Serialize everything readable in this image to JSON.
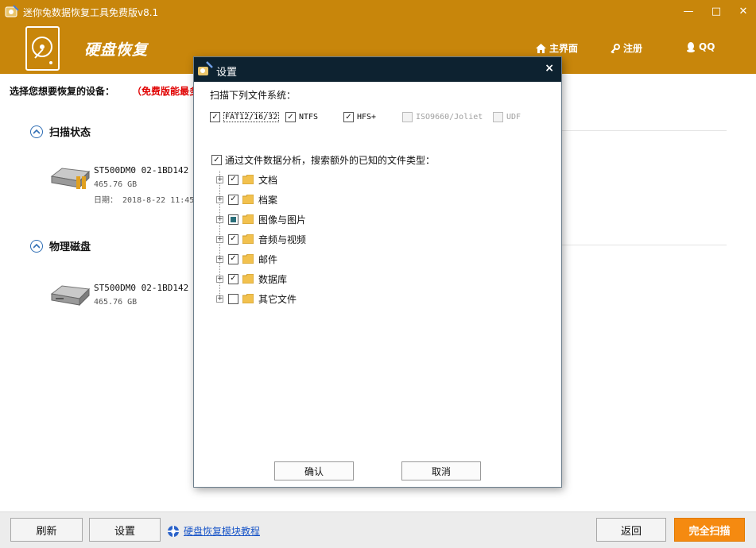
{
  "window": {
    "title": "迷你兔数据恢复工具免费版v8.1",
    "controls": {
      "minimize": "—",
      "maximize": "□",
      "close": "✕"
    }
  },
  "header": {
    "brand": "硬盘恢复",
    "nav": {
      "home": "主界面",
      "register": "注册",
      "qq": "QQ"
    }
  },
  "main": {
    "prompt": "选择您想要恢复的设备：",
    "notice": "（免费版能最多",
    "sections": [
      {
        "title": "扫描状态",
        "device": {
          "name": "ST500DM0 02-1BD142",
          "size": "465.76 GB",
          "date": "日期： 2018-8-22 11:45"
        }
      },
      {
        "title": "物理磁盘",
        "device": {
          "name": "ST500DM0 02-1BD142",
          "size": "465.76 GB"
        }
      }
    ]
  },
  "footer": {
    "refresh": "刷新",
    "settings": "设置",
    "tutorial": "硬盘恢复模块教程",
    "back": "返回",
    "full_scan": "完全扫描"
  },
  "dialog": {
    "title": "设置",
    "close": "×",
    "fs_label": "扫描下列文件系统：",
    "filesystems": [
      {
        "label": "FAT12/16/32",
        "checked": true,
        "enabled": true
      },
      {
        "label": "NTFS",
        "checked": true,
        "enabled": true
      },
      {
        "label": "HFS+",
        "checked": true,
        "enabled": true
      },
      {
        "label": "ISO9660/Joliet",
        "checked": false,
        "enabled": false
      },
      {
        "label": "UDF",
        "checked": false,
        "enabled": false
      }
    ],
    "analysis_label": "通过文件数据分析，搜索额外的已知的文件类型：",
    "analysis_checked": true,
    "types": [
      {
        "label": "文档",
        "state": "checked"
      },
      {
        "label": "档案",
        "state": "checked"
      },
      {
        "label": "图像与图片",
        "state": "partial"
      },
      {
        "label": "音频与视频",
        "state": "checked"
      },
      {
        "label": "邮件",
        "state": "checked"
      },
      {
        "label": "数据库",
        "state": "checked"
      },
      {
        "label": "其它文件",
        "state": "unchecked"
      }
    ],
    "ok": "确认",
    "cancel": "取消"
  }
}
